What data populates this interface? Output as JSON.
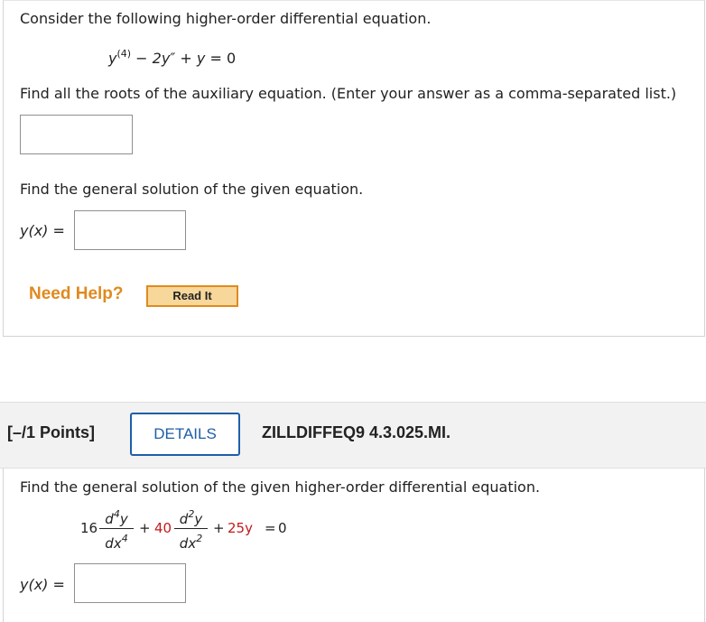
{
  "q1": {
    "intro": "Consider the following higher-order differential equation.",
    "equation": {
      "y": "y",
      "order_sup": "(4)",
      "minus": "−",
      "term2": "2y″",
      "plus": "+",
      "term3": "y",
      "equals": "=",
      "rhs": "0"
    },
    "roots_prompt": "Find all the roots of the auxiliary equation. (Enter your answer as a comma-separated list.)",
    "roots_value": "",
    "general_prompt": "Find the general solution of the given equation.",
    "yx_label": "y(x) =",
    "yx_value": "",
    "need_help": "Need Help?",
    "read_it": "Read It"
  },
  "q2": {
    "points": "[–/1 Points]",
    "details": "DETAILS",
    "code": "ZILLDIFFEQ9 4.3.025.MI.",
    "prompt": "Find the general solution of the given higher-order differential equation.",
    "equation": {
      "coef1": "16",
      "num1": "d",
      "num1_sup": "4",
      "num1_y": "y",
      "den1": "dx",
      "den1_sup": "4",
      "plus1": "+",
      "coef2": "40",
      "num2": "d",
      "num2_sup": "2",
      "num2_y": "y",
      "den2": "dx",
      "den2_sup": "2",
      "plus2": "+",
      "term3": "25y",
      "equals": "=",
      "rhs": "0"
    },
    "yx_label": "y(x) =",
    "yx_value": ""
  },
  "colors": {
    "help_orange": "#e08a1e",
    "details_blue": "#1f5ea8",
    "coef_red": "#c21a1a"
  }
}
